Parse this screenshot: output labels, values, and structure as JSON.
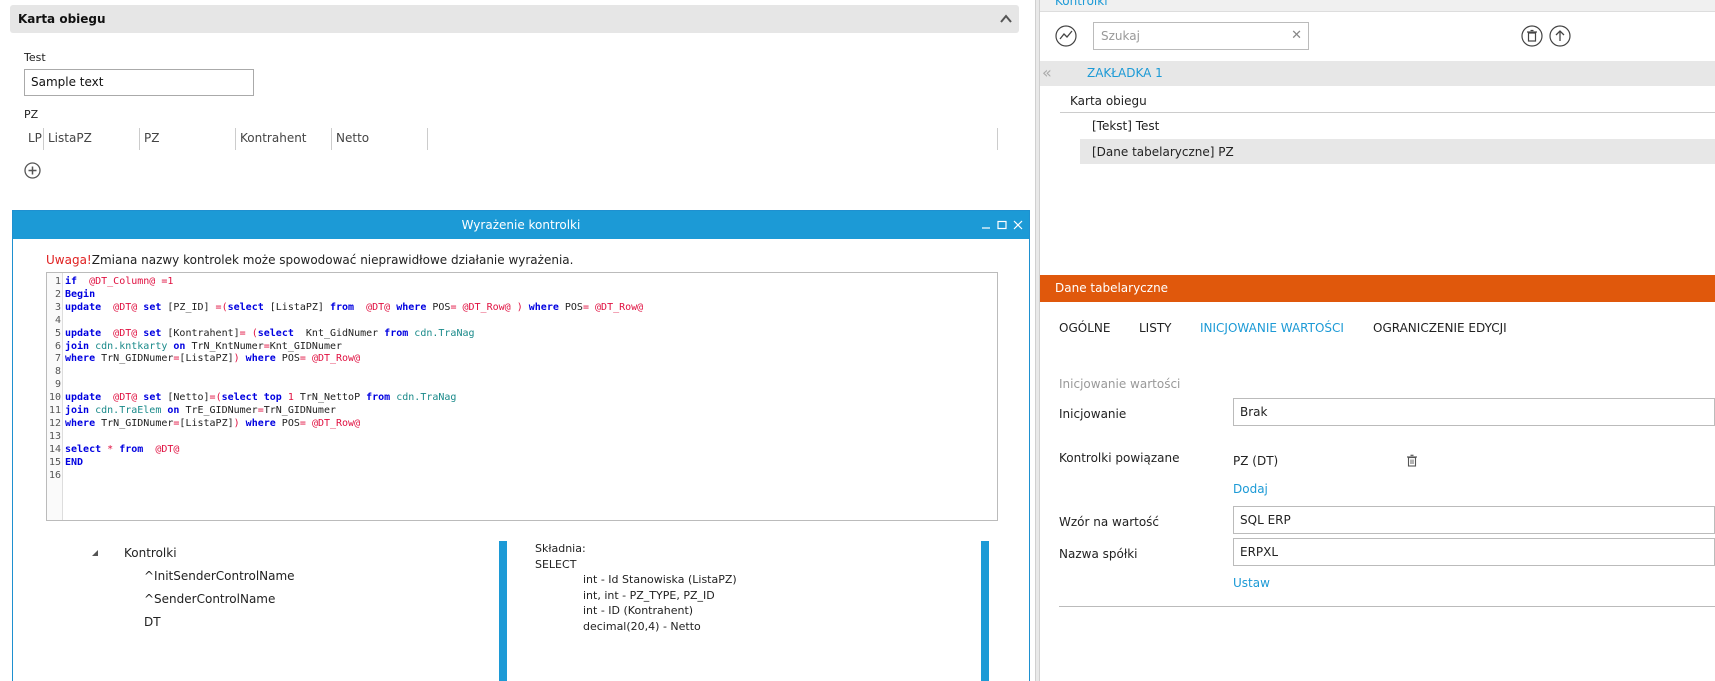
{
  "form": {
    "section_title": "Karta obiegu",
    "test_label": "Test",
    "test_value": "Sample text",
    "pz_label": "PZ",
    "pz_columns": [
      "LP",
      "ListaPZ",
      "PZ",
      "Kontrahent",
      "Netto"
    ]
  },
  "dialog": {
    "title": "Wyrażenie kontrolki",
    "warning_prefix": "Uwaga!",
    "warning_text": "Zmiana nazwy kontrolek może spowodować nieprawidłowe działanie wyrażenia.",
    "code_lines": [
      "if  @DT_Column@ =1",
      "Begin",
      "update  @DT@ set [PZ_ID] =(select [ListaPZ] from  @DT@ where POS= @DT_Row@ ) where POS= @DT_Row@",
      "",
      "update  @DT@ set [Kontrahent]= (select  Knt_GidNumer from cdn.TraNag",
      "join cdn.kntkarty on TrN_KntNumer=Knt_GIDNumer",
      "where TrN_GIDNumer=[ListaPZ]) where POS= @DT_Row@",
      "",
      "",
      "update  @DT@ set [Netto]=(select top 1 TrN_NettoP from cdn.TraNag",
      "join cdn.TraElem on TrE_GIDNumer=TrN_GIDNumer",
      "where TrN_GIDNumer=[ListaPZ]) where POS= @DT_Row@",
      "",
      "select * from  @DT@",
      "END",
      ""
    ],
    "tree": {
      "root": "Kontrolki",
      "items": [
        "^InitSenderControlName",
        "^SenderControlName",
        "DT"
      ]
    },
    "syntax": {
      "title": "Składnia:",
      "lines": [
        "SELECT",
        "int - Id Stanowiska (ListaPZ)",
        "int, int - PZ_TYPE, PZ_ID",
        "int - ID (Kontrahent)",
        "decimal(20,4) - Netto"
      ]
    }
  },
  "right": {
    "panel_title": "Kontrolki",
    "search_placeholder": "Szukaj",
    "tab_label": "ZAKŁADKA 1",
    "tree": [
      "Karta obiegu",
      "[Tekst] Test",
      "[Dane tabelaryczne] PZ"
    ],
    "props_title": "Dane tabelaryczne",
    "props_tabs": [
      "OGÓLNE",
      "LISTY",
      "INICJOWANIE WARTOŚCI",
      "OGRANICZENIE EDYCJI"
    ],
    "section_label": "Inicjowanie wartości",
    "init_label": "Inicjowanie",
    "init_value": "Brak",
    "linked_label": "Kontrolki powiązane",
    "linked_value": "PZ (DT)",
    "add_link": "Dodaj",
    "pattern_label": "Wzór na wartość",
    "pattern_value": "SQL ERP",
    "company_label": "Nazwa spółki",
    "company_value": "ERPXL",
    "set_link": "Ustaw"
  },
  "colors": {
    "accent": "#1c9ad6",
    "props_header": "#e0580c",
    "warning": "#e02020"
  }
}
